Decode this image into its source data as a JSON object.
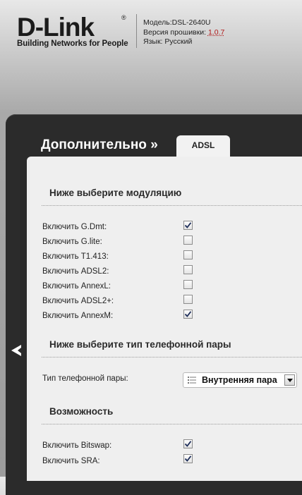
{
  "header": {
    "logo_text": "D-Link",
    "logo_tagline": "Building Networks for People",
    "model_label": "Модель:",
    "model_value": "DSL-2640U",
    "firmware_label": "Версия прошивки: ",
    "firmware_value": "1.0.7",
    "language_label": "Язык: ",
    "language_value": "Русский"
  },
  "nav": {
    "section_title": "Дополнительно »",
    "tab_label": "ADSL"
  },
  "modulation": {
    "heading": "Ниже выберите модуляцию",
    "items": [
      {
        "label": "Включить G.Dmt:",
        "checked": true
      },
      {
        "label": "Включить G.lite:",
        "checked": false
      },
      {
        "label": "Включить T1.413:",
        "checked": false
      },
      {
        "label": "Включить ADSL2:",
        "checked": false
      },
      {
        "label": "Включить AnnexL:",
        "checked": false
      },
      {
        "label": "Включить ADSL2+:",
        "checked": false
      },
      {
        "label": "Включить AnnexM:",
        "checked": true
      }
    ]
  },
  "phone_pair": {
    "heading": "Ниже выберите тип телефонной пары",
    "label": "Тип телефонной пары:",
    "selected": "Внутренняя пара"
  },
  "capability": {
    "heading": "Возможность",
    "items": [
      {
        "label": "Включить Bitswap:",
        "checked": true
      },
      {
        "label": "Включить SRA:",
        "checked": true
      }
    ]
  }
}
